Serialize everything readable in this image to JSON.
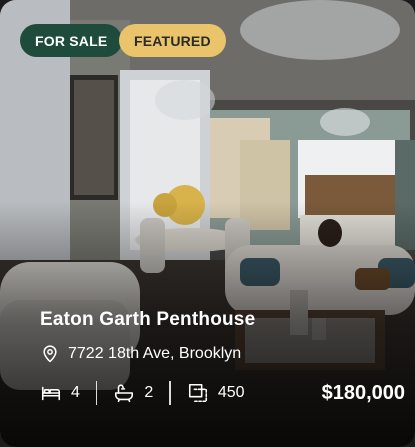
{
  "listing": {
    "badges": {
      "status": "FOR SALE",
      "featured": "FEATURED"
    },
    "title": "Eaton Garth Penthouse",
    "address": "7722 18th Ave, Brooklyn",
    "specs": {
      "beds": "4",
      "baths": "2",
      "area": "450"
    },
    "price": "$180,000",
    "icons": {
      "address": "location-pin-icon",
      "beds": "bed-icon",
      "baths": "bathtub-icon",
      "area": "area-icon"
    }
  },
  "colors": {
    "status_badge_bg": "#1f4b3d",
    "featured_badge_bg": "#e9c46a",
    "text": "#ffffff"
  }
}
